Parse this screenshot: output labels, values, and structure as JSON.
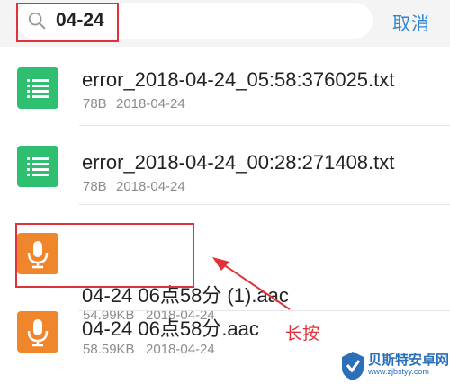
{
  "search": {
    "value": "04-24",
    "icon": "search-icon"
  },
  "cancel_label": "取消",
  "files": [
    {
      "name": "error_2018-04-24_05:58:376025.txt",
      "size": "78B",
      "date": "2018-04-24",
      "icon": "document-list-icon",
      "type": "txt"
    },
    {
      "name": "error_2018-04-24_00:28:271408.txt",
      "size": "78B",
      "date": "2018-04-24",
      "icon": "document-list-icon",
      "type": "txt"
    },
    {
      "name": "04-24 06点58分 (1).aac",
      "size": "54.99KB",
      "date": "2018-04-24",
      "icon": "microphone-icon",
      "type": "audio"
    },
    {
      "name": "04-24 06点58分.aac",
      "size": "58.59KB",
      "date": "2018-04-24",
      "icon": "microphone-icon",
      "type": "audio"
    }
  ],
  "annotation": {
    "label": "长按",
    "color": "#e0323a"
  },
  "watermark": {
    "text": "贝斯特安卓网",
    "url": "www.zjbstyy.com"
  },
  "colors": {
    "accent": "#2e86d4",
    "txt_icon": "#2fbf70",
    "audio_icon": "#f0862c",
    "highlight": "#e0323a"
  }
}
